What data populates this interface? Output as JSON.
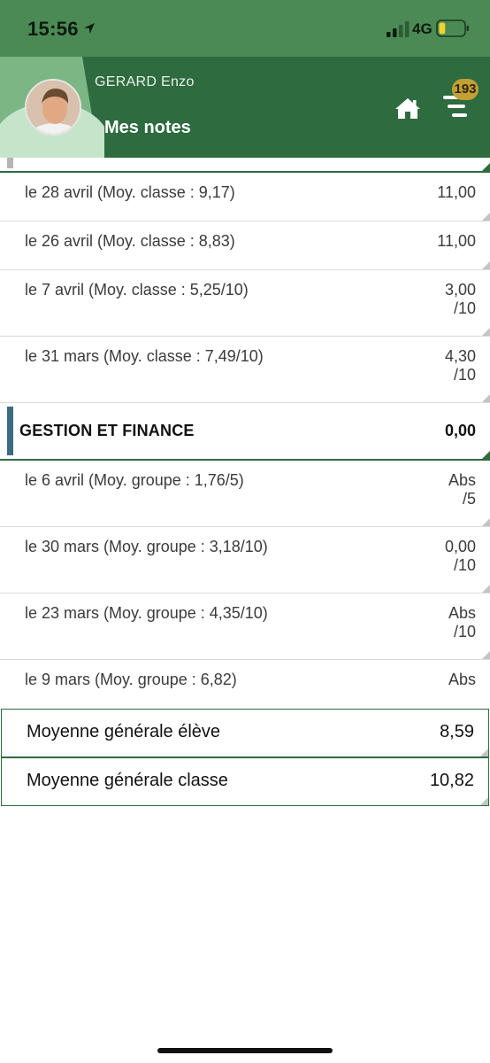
{
  "status_bar": {
    "time": "15:56",
    "network": "4G",
    "battery_level": 0.25,
    "battery_color": "#f2d22e"
  },
  "header": {
    "user_name": "GERARD Enzo",
    "title": "Mes notes",
    "badge_count": "193",
    "colors": {
      "bar": "#2e6b3f",
      "status": "#4b8a55",
      "accent": "#c2a033"
    }
  },
  "grades_previous": [
    {
      "label": "le 28 avril (Moy. classe : 9,17)",
      "value": "11,00",
      "scale": ""
    },
    {
      "label": "le 26 avril (Moy. classe : 8,83)",
      "value": "11,00",
      "scale": ""
    },
    {
      "label": "le 7 avril (Moy. classe : 5,25/10)",
      "value": "3,00",
      "scale": "/10"
    },
    {
      "label": "le 31 mars (Moy. classe : 7,49/10)",
      "value": "4,30",
      "scale": "/10"
    }
  ],
  "subject": {
    "name": "GESTION ET FINANCE",
    "average": "0,00",
    "color": "#3d6b80",
    "grades": [
      {
        "label": "le 6 avril (Moy. groupe : 1,76/5)",
        "value": "Abs",
        "scale": "/5"
      },
      {
        "label": "le 30 mars (Moy. groupe : 3,18/10)",
        "value": "0,00",
        "scale": "/10"
      },
      {
        "label": "le 23 mars (Moy. groupe : 4,35/10)",
        "value": "Abs",
        "scale": "/10"
      },
      {
        "label": "le 9 mars (Moy. groupe : 6,82)",
        "value": "Abs",
        "scale": ""
      }
    ]
  },
  "summary": {
    "student_label": "Moyenne générale élève",
    "student_value": "8,59",
    "class_label": "Moyenne générale classe",
    "class_value": "10,82"
  }
}
